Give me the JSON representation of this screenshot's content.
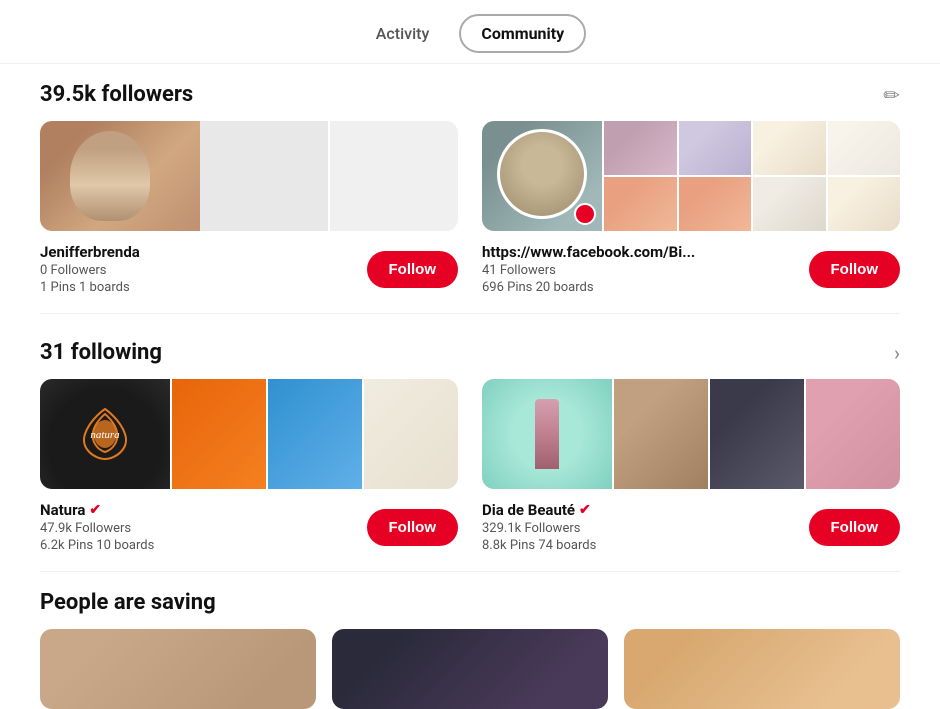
{
  "tabs": [
    {
      "id": "activity",
      "label": "Activity",
      "active": false
    },
    {
      "id": "community",
      "label": "Community",
      "active": true
    }
  ],
  "followers_section": {
    "title": "39.5k followers",
    "cards": [
      {
        "name": "Jenifferbrenda",
        "verified": false,
        "followers": "0 Followers",
        "pins_boards": "1 Pins 1 boards",
        "follow_label": "Follow"
      },
      {
        "name": "https://www.facebook.com/Bi...",
        "verified": false,
        "followers": "41 Followers",
        "pins_boards": "696 Pins 20 boards",
        "follow_label": "Follow"
      }
    ]
  },
  "following_section": {
    "title": "31 following",
    "cards": [
      {
        "name": "Natura",
        "verified": true,
        "followers": "47.9k Followers",
        "pins_boards": "6.2k Pins 10 boards",
        "follow_label": "Follow"
      },
      {
        "name": "Dia de Beauté",
        "verified": true,
        "followers": "329.1k Followers",
        "pins_boards": "8.8k Pins 74 boards",
        "follow_label": "Follow"
      }
    ]
  },
  "people_saving": {
    "title": "People are saving"
  },
  "icons": {
    "edit": "✏",
    "arrow_right": "›",
    "verified": "✓"
  }
}
